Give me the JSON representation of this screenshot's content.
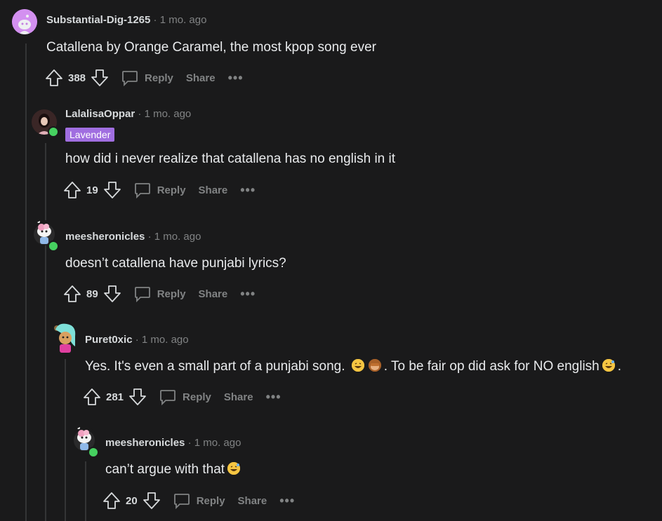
{
  "comments": [
    {
      "author": "Substantial-Dig-1265",
      "time": "1 mo. ago",
      "text": "Catallena by Orange Caramel, the most kpop song ever",
      "votes": "388"
    },
    {
      "author": "LalalisaOppar",
      "time": "1 mo. ago",
      "flair": "Lavender",
      "text": "how did i never realize that catallena has no english in it",
      "votes": "19"
    },
    {
      "author": "meesheronicles",
      "time": "1 mo. ago",
      "text": "doesn’t catallena have punjabi lyrics?",
      "votes": "89"
    },
    {
      "author": "Puret0xic",
      "time": "1 mo. ago",
      "text_part1": "Yes. It's even a small part of a punjabi song.",
      "text_part2": ". To be fair op did ask for NO english",
      "text_part3": ".",
      "votes": "281"
    },
    {
      "author": "meesheronicles",
      "time": "1 mo. ago",
      "text": "can’t argue with that",
      "votes": "20"
    }
  ],
  "labels": {
    "separator": "·",
    "reply": "Reply",
    "share": "Share",
    "more": "•••"
  },
  "colors": {
    "background": "#1a1a1b",
    "flair": "#a06ee0",
    "online": "#46d160",
    "muted": "#818384"
  }
}
